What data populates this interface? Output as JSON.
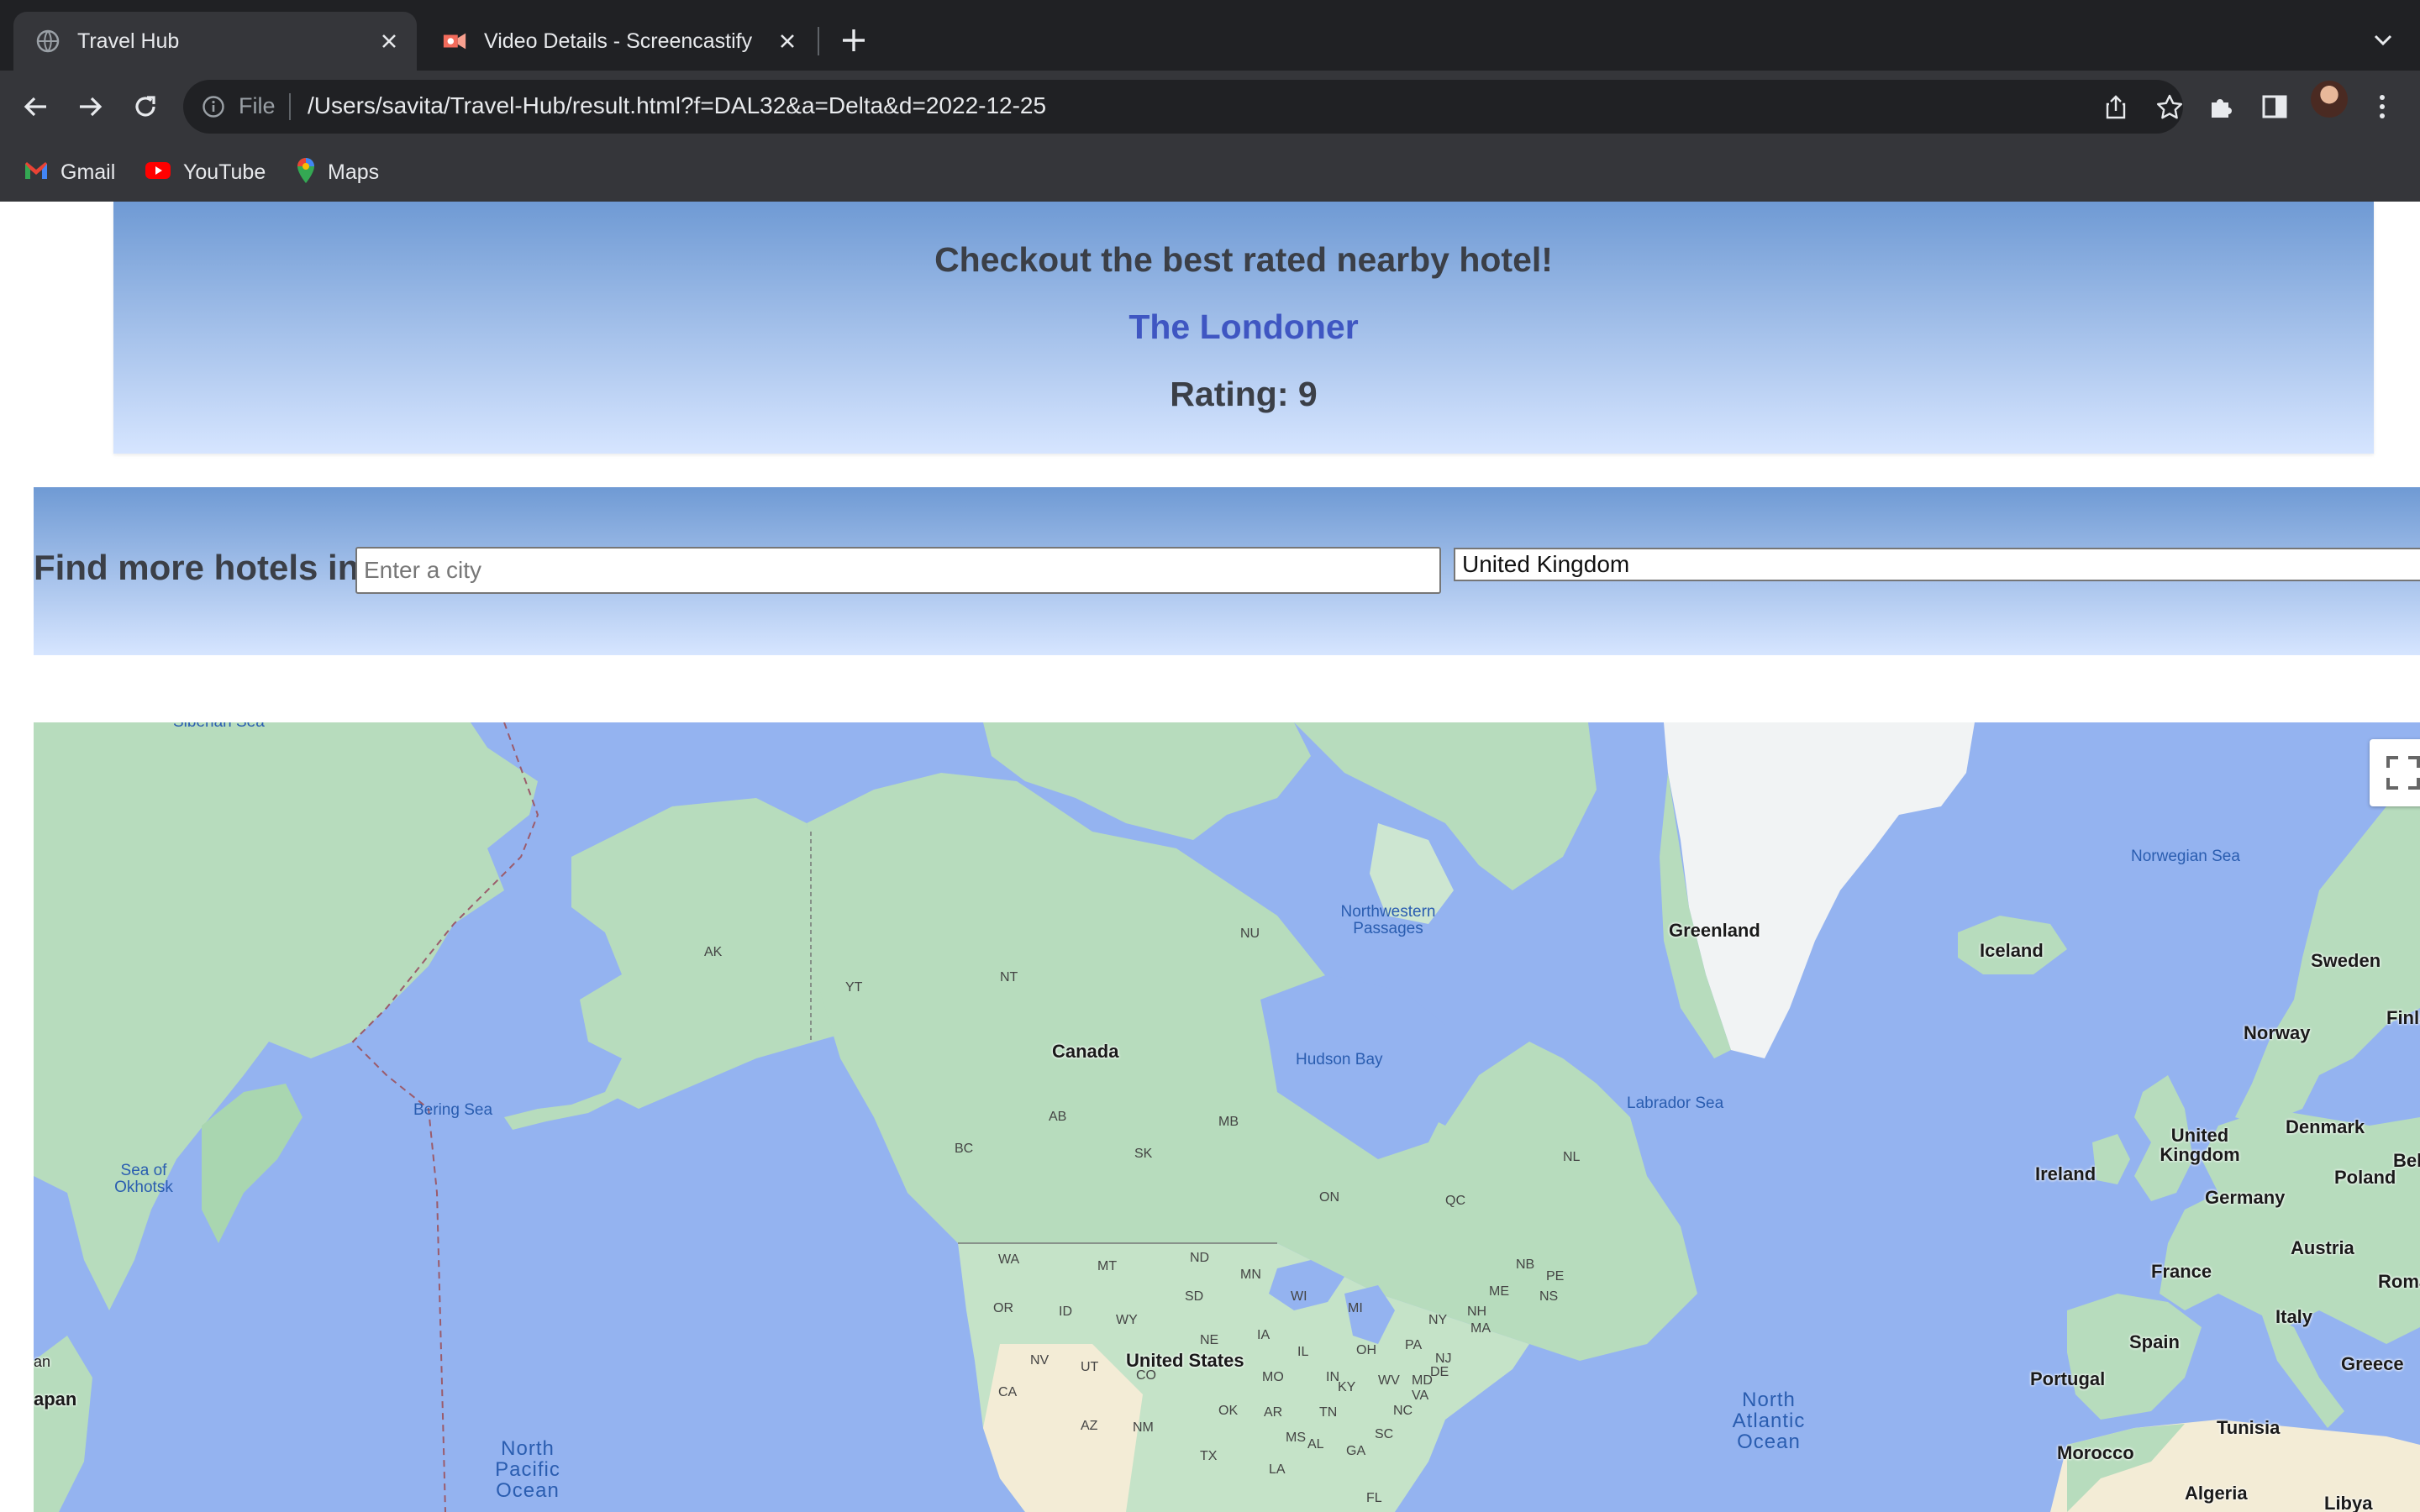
{
  "browser": {
    "tabs": [
      {
        "title": "Travel Hub",
        "active": true,
        "favicon": "globe-icon"
      },
      {
        "title": "Video Details - Screencastify",
        "active": false,
        "favicon": "screencastify-icon"
      }
    ],
    "omnibox": {
      "scheme_label": "File",
      "url": "/Users/savita/Travel-Hub/result.html?f=DAL32&a=Delta&d=2022-12-25"
    },
    "bookmarks": [
      {
        "label": "Gmail",
        "icon": "gmail-icon"
      },
      {
        "label": "YouTube",
        "icon": "youtube-icon"
      },
      {
        "label": "Maps",
        "icon": "maps-icon"
      }
    ]
  },
  "hotel_banner": {
    "heading": "Checkout the best rated nearby hotel!",
    "hotel_name": "The Londoner",
    "rating_text": "Rating: 9"
  },
  "search": {
    "label": "Find more hotels in:",
    "city_placeholder": "Enter a city",
    "city_value": "",
    "country_value": "United Kingdom"
  },
  "map": {
    "colors": {
      "water": "#94b3f0",
      "land": "#b7dcbd",
      "land_dark": "#9fcfa6",
      "ice": "#f1f3f4",
      "desert": "#f3ecd6"
    },
    "labels": {
      "countries": [
        "Greenland",
        "Iceland",
        "Sweden",
        "Norway",
        "Finla",
        "Canada",
        "United Kingdom",
        "Denmark",
        "Bel",
        "Ireland",
        "Germany",
        "Poland",
        "Austria",
        "France",
        "Roman",
        "Italy",
        "Spain",
        "Portugal",
        "Greece",
        "United States",
        "Tunisia",
        "Morocco",
        "Algeria",
        "Libya",
        "apan",
        "an"
      ],
      "states": [
        "AK",
        "YT",
        "NT",
        "NU",
        "BC",
        "AB",
        "SK",
        "MB",
        "ON",
        "QC",
        "NL",
        "NB",
        "PE",
        "NS",
        "WA",
        "MT",
        "ND",
        "MN",
        "OR",
        "ID",
        "WY",
        "SD",
        "WI",
        "MI",
        "NY",
        "ME",
        "NH",
        "MA",
        "NV",
        "UT",
        "NE",
        "IA",
        "IL",
        "IN",
        "OH",
        "PA",
        "NJ",
        "CA",
        "CO",
        "MO",
        "KY",
        "WV",
        "MD",
        "DE",
        "VA",
        "AZ",
        "NM",
        "OK",
        "AR",
        "TN",
        "NC",
        "TX",
        "MS",
        "AL",
        "GA",
        "SC",
        "LA",
        "FL"
      ],
      "water": [
        "Norwegian Sea",
        "Northwestern Passages",
        "Hudson Bay",
        "Labrador Sea",
        "Bering Sea",
        "Sea of Okhotsk",
        "Siberian Sea"
      ],
      "oceans": [
        "North Pacific Ocean",
        "North Atlantic Ocean"
      ]
    }
  }
}
